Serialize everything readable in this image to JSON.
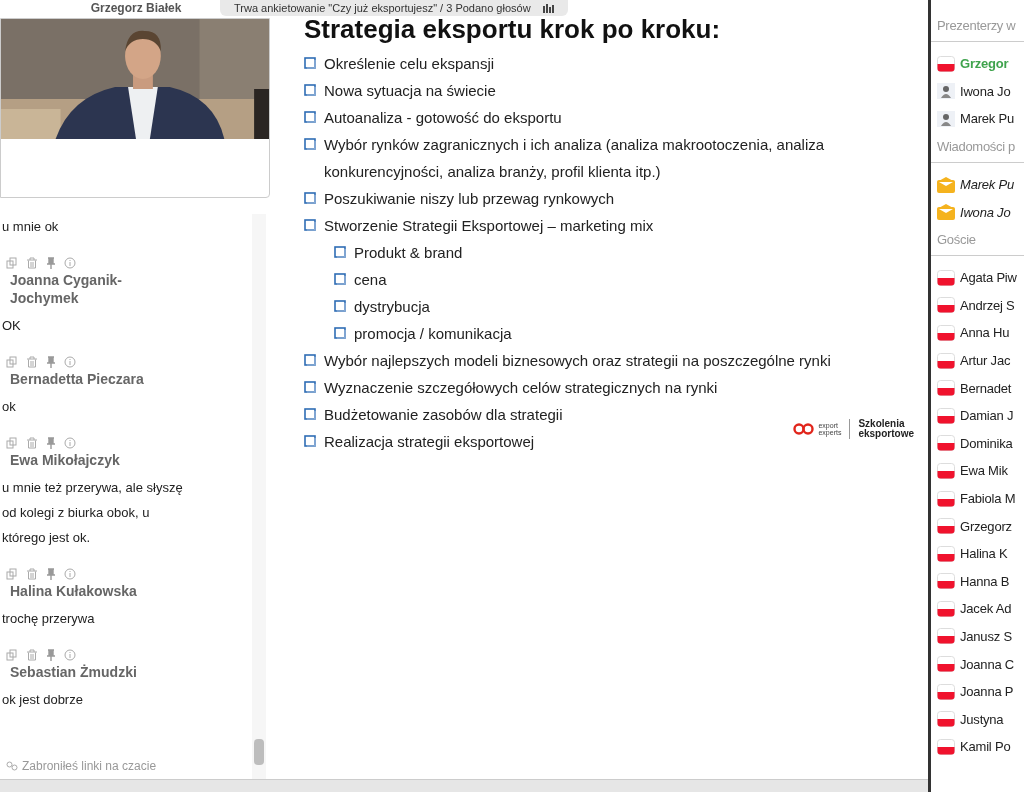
{
  "video": {
    "speaker": "Grzegorz Białek",
    "kind": "picture"
  },
  "poll_bar": {
    "text": "Trwa ankietowanie \"Czy już eksportujesz\" / 3 Podano głosów"
  },
  "chat": {
    "messages": [
      {
        "text": "u mnie ok"
      },
      {
        "author": "Joanna Cyganik-Jochymek",
        "text": "OK"
      },
      {
        "author": "Bernadetta Pieczara",
        "text": "ok"
      },
      {
        "author": "Ewa Mikołajczyk",
        "text": "u mnie też przerywa, ale słyszę od kolegi z biurka obok, u którego jest ok."
      },
      {
        "author": "Halina Kułakowska",
        "text": "trochę przerywa"
      },
      {
        "author": "Sebastian Żmudzki",
        "text": "ok jest dobrze"
      }
    ],
    "notice": "Zabroniłeś linki na czacie"
  },
  "slide": {
    "title": "Strategia eksportu krok po kroku:",
    "items": [
      {
        "text": "Określenie celu ekspansji"
      },
      {
        "text": "Nowa sytuacja na świecie"
      },
      {
        "text": "Autoanaliza - gotowość do eksportu"
      },
      {
        "text": "Wybór rynków zagranicznych i ich analiza (analiza makrootoczenia, analiza konkurencyjności, analiza branży, profil klienta itp.)"
      },
      {
        "text": "Poszukiwanie niszy lub przewag rynkowych"
      },
      {
        "text": "Stworzenie Strategii Eksportowej – marketing mix",
        "children": [
          {
            "text": "Produkt & brand"
          },
          {
            "text": "cena"
          },
          {
            "text": "dystrybucja"
          },
          {
            "text": "promocja /  komunikacja"
          }
        ]
      },
      {
        "text": "Wybór najlepszych modeli biznesowych oraz   strategii na poszczególne rynki"
      },
      {
        "text": "Wyznaczenie szczegółowych celów strategicznych na rynki"
      },
      {
        "text": "Budżetowanie zasobów dla strategii"
      },
      {
        "text": "Realizacja strategii eksportowej"
      }
    ],
    "logo": {
      "brand_top": "export",
      "brand_bottom": "experts",
      "tagline_top": "Szkolenia",
      "tagline_bottom": "eksportowe"
    }
  },
  "participants": {
    "sections": [
      {
        "title": "Prezenterzy w",
        "items": [
          {
            "name": "Grzegor",
            "kind": "flag",
            "highlighted": true
          },
          {
            "name": "Iwona Jo",
            "kind": "avatar",
            "highlighted": false
          },
          {
            "name": "Marek Pu",
            "kind": "avatar",
            "highlighted": false
          }
        ]
      },
      {
        "title": "Wiadomości p",
        "items": [
          {
            "name": "Marek Pu",
            "kind": "envelope",
            "highlighted": false
          },
          {
            "name": "Iwona Jo",
            "kind": "envelope",
            "highlighted": false
          }
        ]
      },
      {
        "title": "Goście",
        "items": [
          {
            "name": "Agata Piw",
            "kind": "flag",
            "highlighted": false
          },
          {
            "name": "Andrzej S",
            "kind": "flag",
            "highlighted": false
          },
          {
            "name": "Anna Hu",
            "kind": "flag",
            "highlighted": false
          },
          {
            "name": "Artur Jac",
            "kind": "flag",
            "highlighted": false
          },
          {
            "name": "Bernadet",
            "kind": "flag",
            "highlighted": false
          },
          {
            "name": "Damian J",
            "kind": "flag",
            "highlighted": false
          },
          {
            "name": "Dominika",
            "kind": "flag",
            "highlighted": false
          },
          {
            "name": "Ewa Mik",
            "kind": "flag",
            "highlighted": false
          },
          {
            "name": "Fabiola M",
            "kind": "flag",
            "highlighted": false
          },
          {
            "name": "Grzegorz",
            "kind": "flag",
            "highlighted": false
          },
          {
            "name": "Halina K",
            "kind": "flag",
            "highlighted": false
          },
          {
            "name": "Hanna B",
            "kind": "flag",
            "highlighted": false
          },
          {
            "name": "Jacek Ad",
            "kind": "flag",
            "highlighted": false
          },
          {
            "name": "Janusz S",
            "kind": "flag",
            "highlighted": false
          },
          {
            "name": "Joanna C",
            "kind": "flag",
            "highlighted": false
          },
          {
            "name": "Joanna P",
            "kind": "flag",
            "highlighted": false
          },
          {
            "name": "Justyna",
            "kind": "flag",
            "highlighted": false
          },
          {
            "name": "Kamil Po",
            "kind": "flag",
            "highlighted": false
          }
        ]
      }
    ]
  }
}
